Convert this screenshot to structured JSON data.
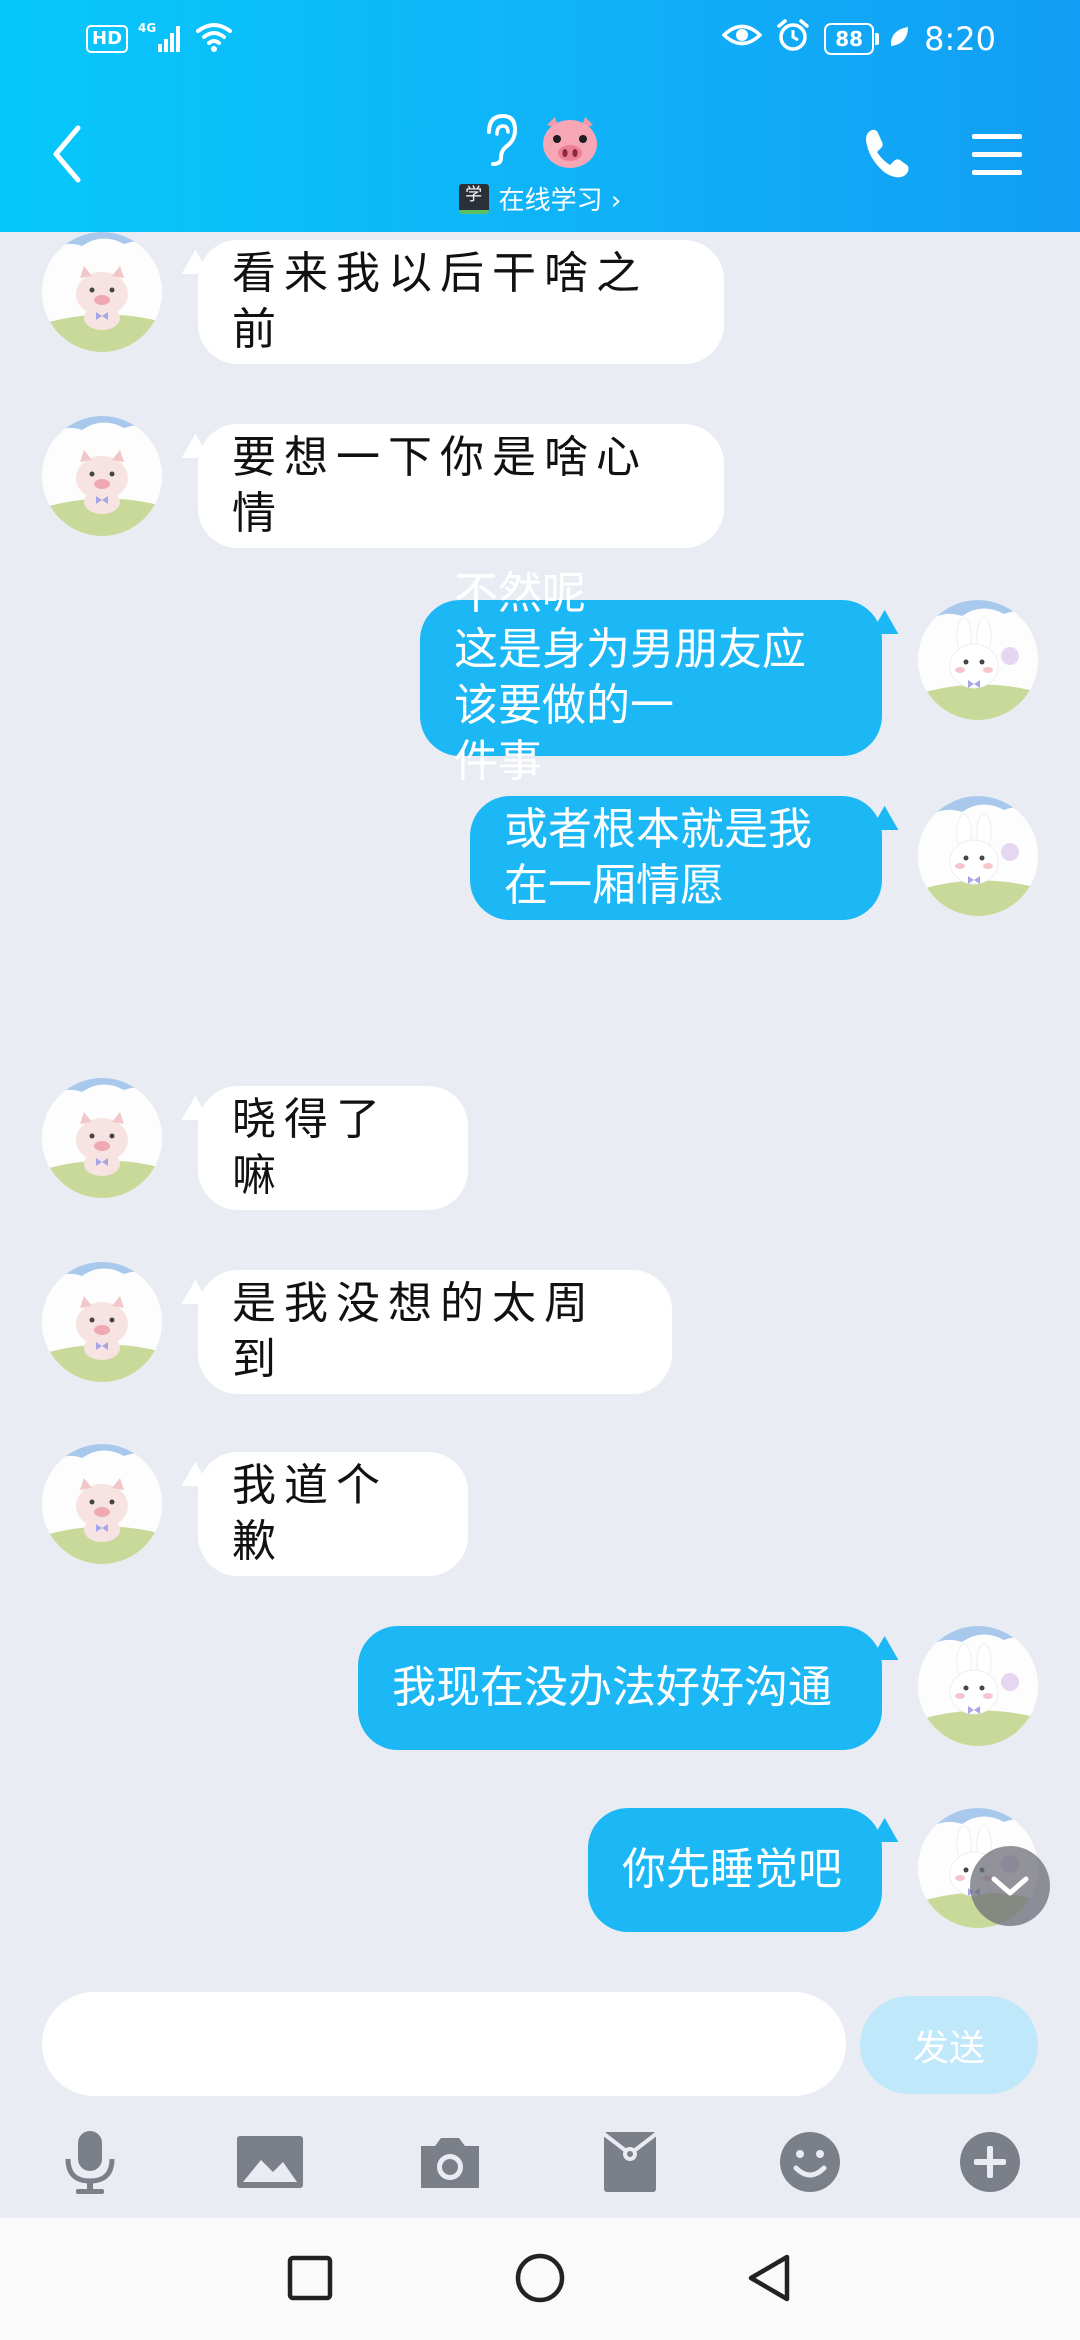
{
  "status_bar": {
    "hd": "HD",
    "network": "4G",
    "battery": "88",
    "time": "8:20"
  },
  "header": {
    "title_icons": [
      "ear-icon",
      "pig-emoji"
    ],
    "subtitle_badge": "学",
    "subtitle": "在线学习 ›"
  },
  "messages": [
    {
      "side": "left",
      "text": "看来我以后干啥之前",
      "avatar": "pig-avatar"
    },
    {
      "side": "left",
      "text": "要想一下你是啥心情",
      "avatar": "pig-avatar"
    },
    {
      "side": "right",
      "text": "不然呢\n这是身为男朋友应该要做的一\n件事",
      "avatar": "bunny-avatar"
    },
    {
      "side": "right",
      "text": "或者根本就是我在一厢情愿",
      "avatar": "bunny-avatar"
    },
    {
      "side": "left",
      "text": "晓得了嘛",
      "avatar": "pig-avatar"
    },
    {
      "side": "left",
      "text": "是我没想的太周到",
      "avatar": "pig-avatar"
    },
    {
      "side": "left",
      "text": "我道个歉",
      "avatar": "pig-avatar"
    },
    {
      "side": "right",
      "text": "我现在没办法好好沟通",
      "avatar": "bunny-avatar"
    },
    {
      "side": "right",
      "text": "你先睡觉吧",
      "avatar": "bunny-avatar"
    }
  ],
  "input": {
    "value": "",
    "placeholder": ""
  },
  "send_label": "发送",
  "toolbar": [
    "mic-icon",
    "image-icon",
    "camera-icon",
    "red-packet-icon",
    "emoji-icon",
    "plus-icon"
  ],
  "colors": {
    "header_start": "#06c8fa",
    "header_end": "#129ef4",
    "outgoing_bubble": "#1cb7f5",
    "incoming_bubble": "#ffffff",
    "chat_background": "#e9ecf3",
    "send_button": "#bfe8fb"
  }
}
